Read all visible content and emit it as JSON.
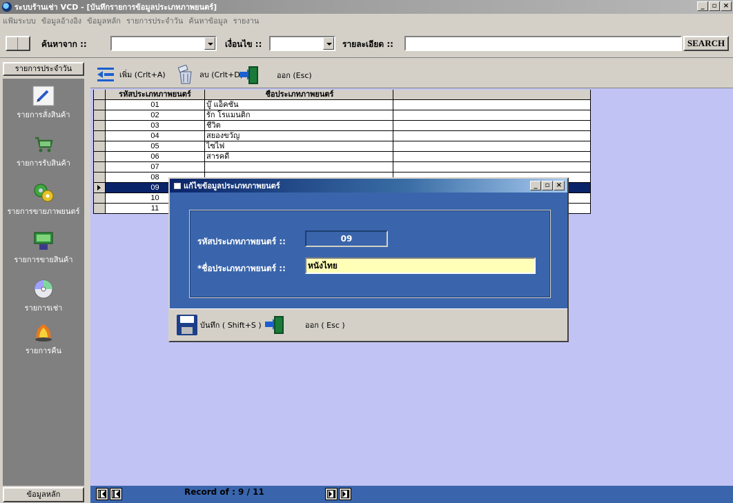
{
  "window": {
    "title": "ระบบร้านเช่า VCD - [บันทึกรายการข้อมูลประเภทภาพยนตร์]",
    "min": "_",
    "max": "▫",
    "close": "×"
  },
  "menu": [
    "แฟ้มระบบ",
    "ข้อมูลอ้างอิง",
    "ข้อมูลหลัก",
    "รายการประจำวัน",
    "ค้นหาข้อมูล",
    "รายงาน"
  ],
  "search": {
    "from_label": "ค้นหาจาก ::",
    "condition_label": "เงื่อนไข ::",
    "detail_label": "รายละเอียด ::",
    "from_value": "",
    "condition_value": "",
    "detail_value": "",
    "button": "SEARCH"
  },
  "sidebar": {
    "header": "รายการประจำวัน",
    "items": [
      {
        "label": "รายการสั่งสินค้า",
        "icon": "pen-icon"
      },
      {
        "label": "รายการรับสินค้า",
        "icon": "cart-icon"
      },
      {
        "label": "รายการขายภาพยนตร์",
        "icon": "film-icon"
      },
      {
        "label": "รายการขายสินค้า",
        "icon": "product-icon"
      },
      {
        "label": "รายการเช่า",
        "icon": "disc-icon"
      },
      {
        "label": "รายการคืน",
        "icon": "return-icon"
      }
    ],
    "footer": "ข้อมูลหลัก"
  },
  "toolbar": {
    "add": "เพิ่ม (Crlt+A)",
    "delete": "ลบ (Crlt+D)",
    "exit": "ออก (Esc)"
  },
  "grid": {
    "headers": [
      "รหัสประเภทภาพยนตร์",
      "ชื่อประเภทภาพยนตร์"
    ],
    "rows": [
      {
        "code": "01",
        "name": "บู๊ แอ็คชั่น"
      },
      {
        "code": "02",
        "name": "รัก โรแมนติก"
      },
      {
        "code": "03",
        "name": "ชีวิต"
      },
      {
        "code": "04",
        "name": "สยองขวัญ"
      },
      {
        "code": "05",
        "name": "ไซไฟ"
      },
      {
        "code": "06",
        "name": "สารคดี"
      },
      {
        "code": "07",
        "name": ""
      },
      {
        "code": "08",
        "name": ""
      },
      {
        "code": "09",
        "name": ""
      },
      {
        "code": "10",
        "name": ""
      },
      {
        "code": "11",
        "name": ""
      }
    ],
    "selected_index": 8
  },
  "navigator": {
    "record_text": "Record of  :  9 / 11"
  },
  "dialog": {
    "title": "แก้ไขข้อมูลประเภทภาพยนตร์",
    "code_label": "รหัสประเภทภาพยนตร์ ::",
    "code_value": "09",
    "name_label": "*ชื่อประเภทภาพยนตร์ ::",
    "name_value": "หนังไทย",
    "save": "บันทึก ( Shift+S )",
    "exit": "ออก ( Esc )"
  },
  "colors": {
    "app_bg": "#d4d0c8",
    "main_bg": "#c2c3f5",
    "dialog_bg": "#3a65ac",
    "selection": "#0a246a",
    "name_field": "#ffffb8"
  }
}
